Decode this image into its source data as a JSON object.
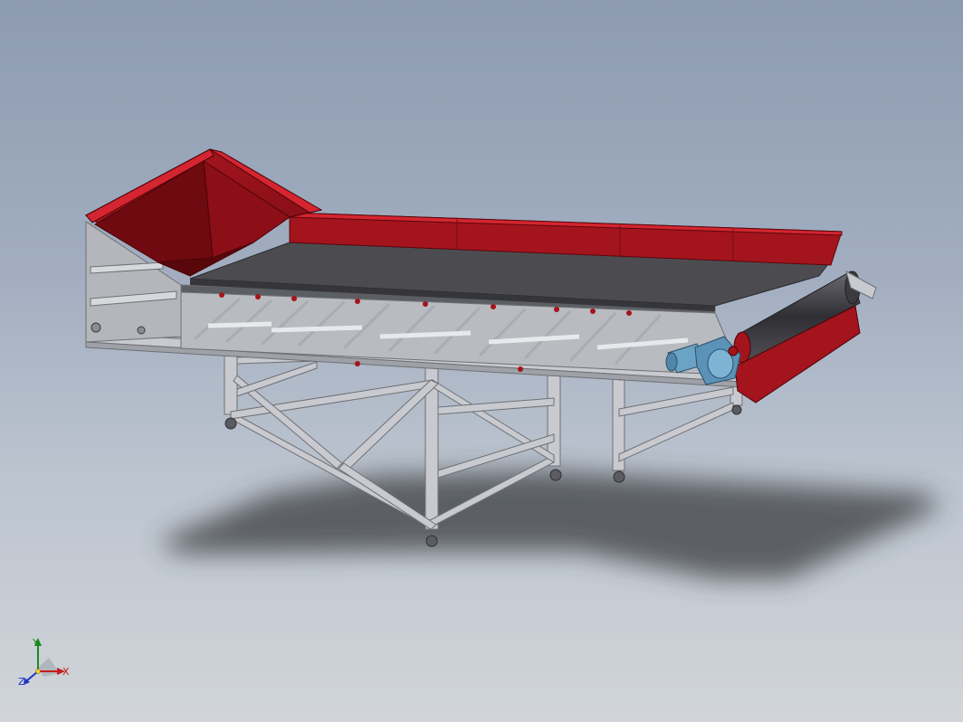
{
  "viewport": {
    "background_top": "#8d9bb1",
    "background_bottom": "#d1d5d9"
  },
  "model": {
    "frame_color": "#c5c7cc",
    "hopper_color": "#a4141d",
    "belt_color": "#4c4c50",
    "motor_color": "#6aa3c6"
  },
  "triad": {
    "x_label": "X",
    "y_label": "Y",
    "z_label": "Z",
    "x_color": "#c41e1e",
    "y_color": "#1c8a1c",
    "z_color": "#1e35c4"
  }
}
